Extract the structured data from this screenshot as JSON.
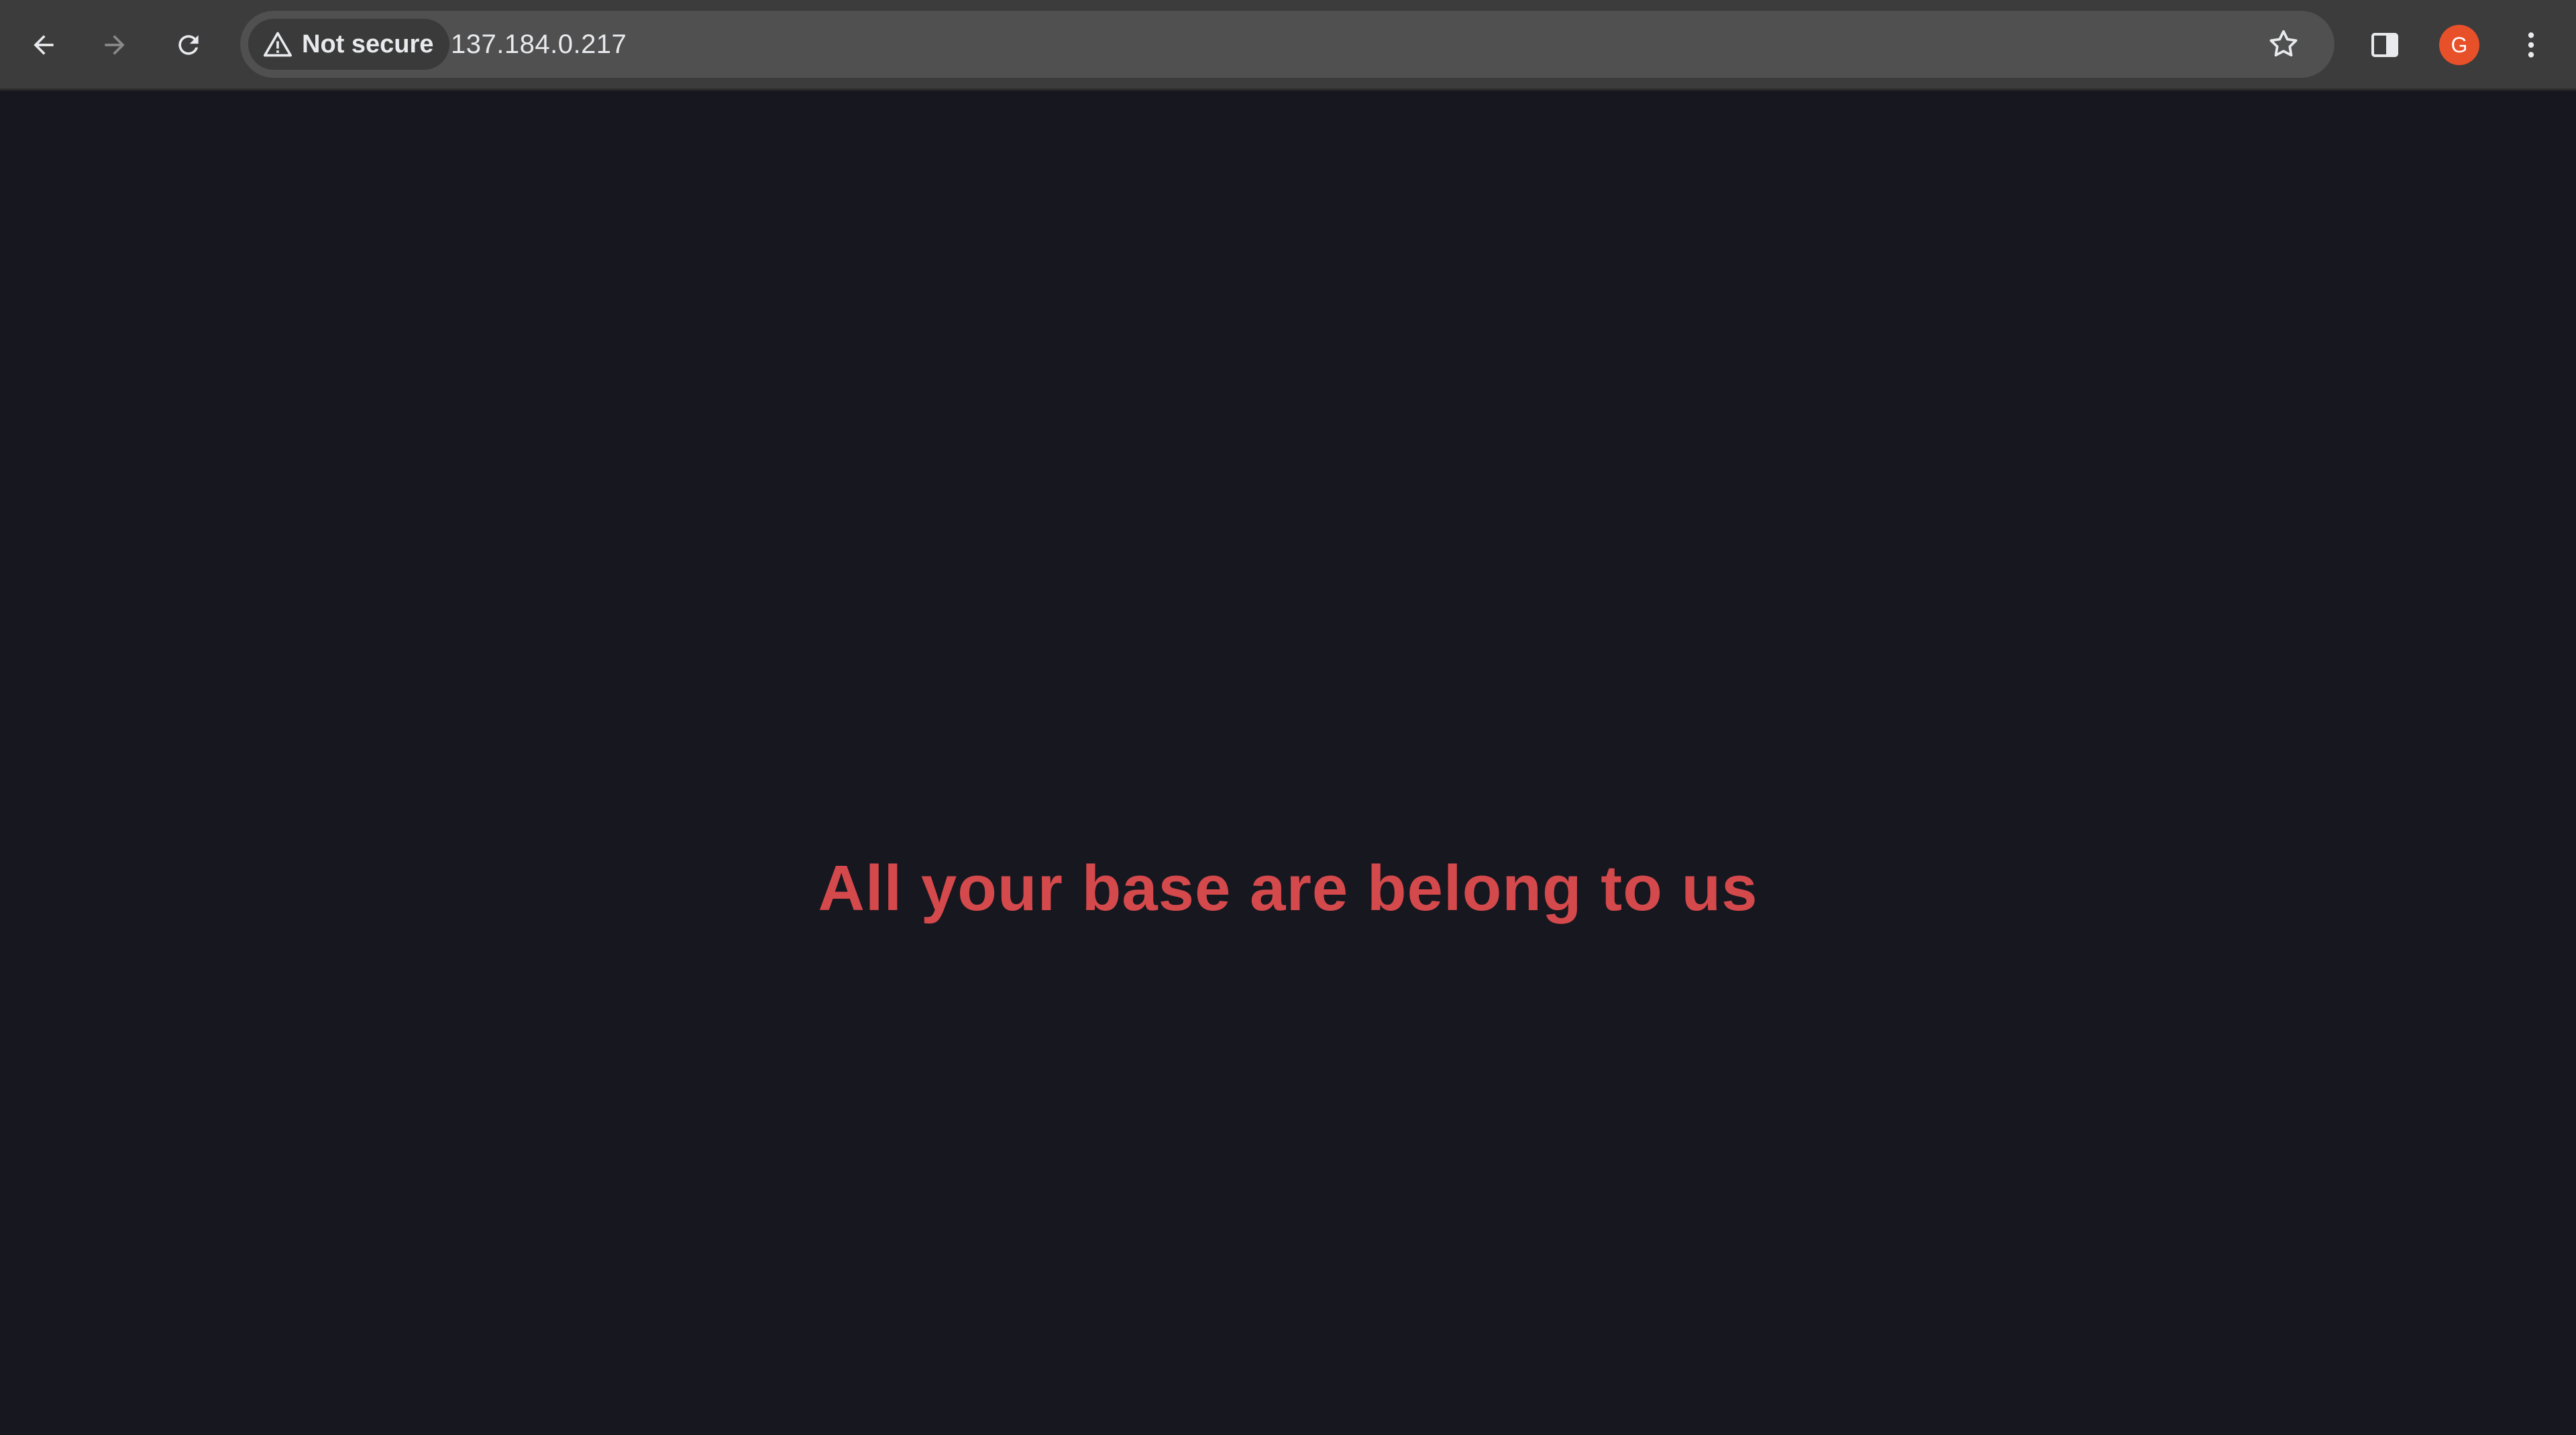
{
  "browser": {
    "security_label": "Not secure",
    "url": "137.184.0.217",
    "profile_initial": "G",
    "icons": {
      "back": "arrow-left-icon",
      "forward": "arrow-right-icon",
      "reload": "reload-icon",
      "security": "warning-triangle-icon",
      "bookmark": "star-icon",
      "side_panel": "side-panel-icon",
      "menu": "kebab-menu-icon"
    },
    "colors": {
      "toolbar": "#3c3c3c",
      "omnibox": "#505050",
      "avatar": "#e8502a",
      "icon_active": "#e8eaed",
      "icon_disabled": "#8a8a8a"
    }
  },
  "page": {
    "headline": "All your base are belong to us",
    "colors": {
      "background": "#171720",
      "headline": "#d4494b"
    }
  }
}
